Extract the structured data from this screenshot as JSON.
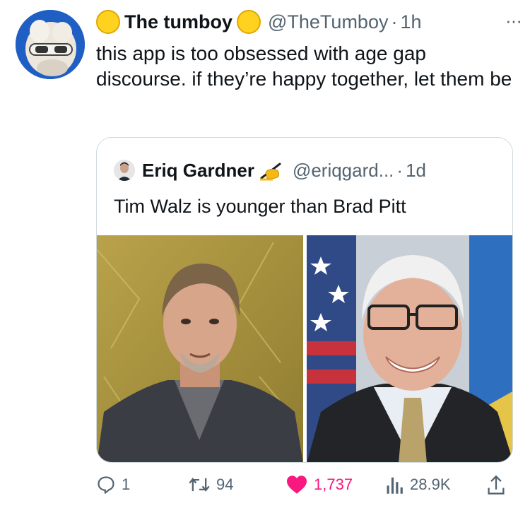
{
  "tweet": {
    "display_name": "The tumboy",
    "handle": "@TheTumboy",
    "separator": "·",
    "time": "1h",
    "more": "···",
    "text": "this app is too obsessed with age gap discourse. if they’re happy together, let them be"
  },
  "quoted_tweet": {
    "display_name": "Eriq Gardner",
    "name_emoji": "✍",
    "handle": "@eriqgard...",
    "separator": "·",
    "time": "1d",
    "text": "Tim Walz is younger than Brad Pitt"
  },
  "actions": {
    "replies": "1",
    "retweets": "94",
    "likes": "1,737",
    "views": "28.9K"
  },
  "colors": {
    "like": "#f91880",
    "secondary_text": "#536471",
    "border": "#cfd9de",
    "emoji_yellow": "#ffd21f"
  },
  "icons": [
    "reply-icon",
    "retweet-icon",
    "heart-icon",
    "views-icon",
    "share-icon"
  ]
}
